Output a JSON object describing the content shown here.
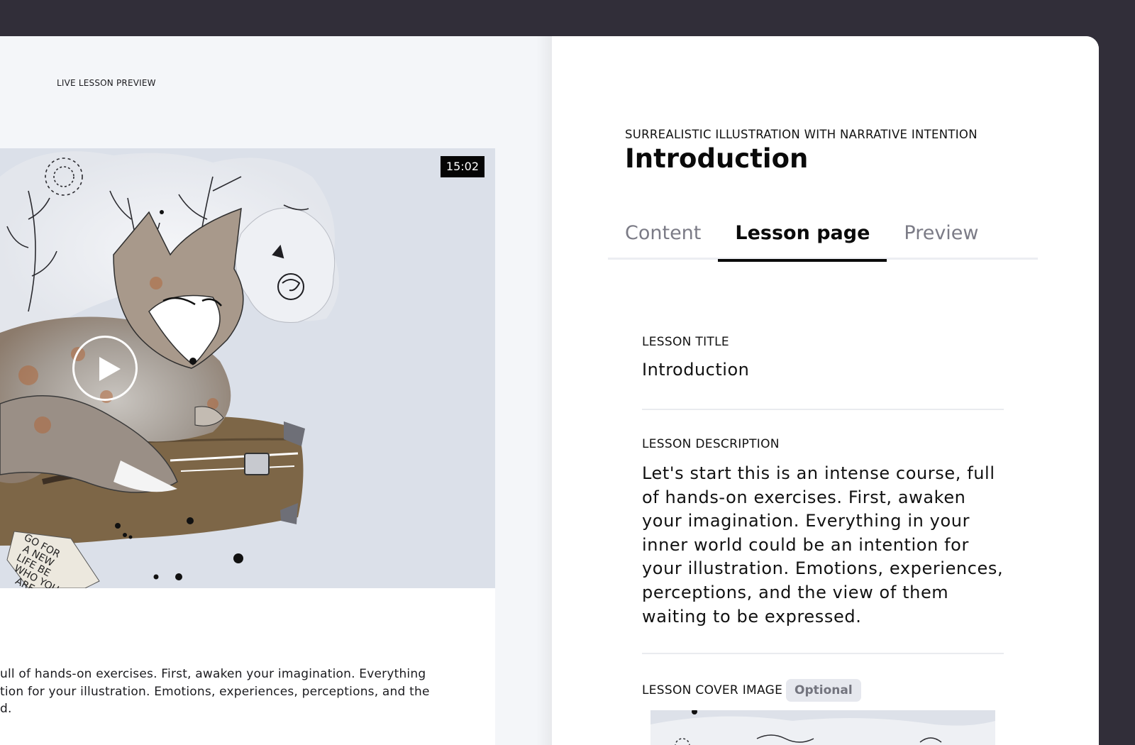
{
  "preview": {
    "label": "LIVE LESSON PREVIEW",
    "video": {
      "duration": "15:02"
    },
    "sign_text": [
      "GO FOR",
      "A NEW",
      "LIFE BE",
      "WHO YOU",
      "ARE"
    ],
    "description_partial": "ull of hands-on exercises. First, awaken your imagination. Everything\ntion for your illustration. Emotions, experiences, perceptions, and the\nd."
  },
  "editor": {
    "course_name": "SURREALISTIC ILLUSTRATION WITH NARRATIVE INTENTION",
    "lesson_heading": "Introduction",
    "tabs": [
      {
        "label": "Content",
        "active": false
      },
      {
        "label": "Lesson page",
        "active": true
      },
      {
        "label": "Preview",
        "active": false
      }
    ],
    "fields": {
      "title_label": "LESSON TITLE",
      "title_value": "Introduction",
      "description_label": "LESSON DESCRIPTION",
      "description_value": "Let's start this is an intense course, full of hands-on exercises. First, awaken your imagination. Everything in your inner world could be an intention for your illustration. Emotions, experiences, perceptions, and the view of them waiting to be expressed.",
      "cover_label": "LESSON COVER IMAGE",
      "cover_badge": "Optional"
    }
  },
  "colors": {
    "background": "#312e39",
    "preview_bg": "#f4f6f9",
    "video_bg": "#dbe0e9",
    "accent": "#0a0a0a"
  }
}
